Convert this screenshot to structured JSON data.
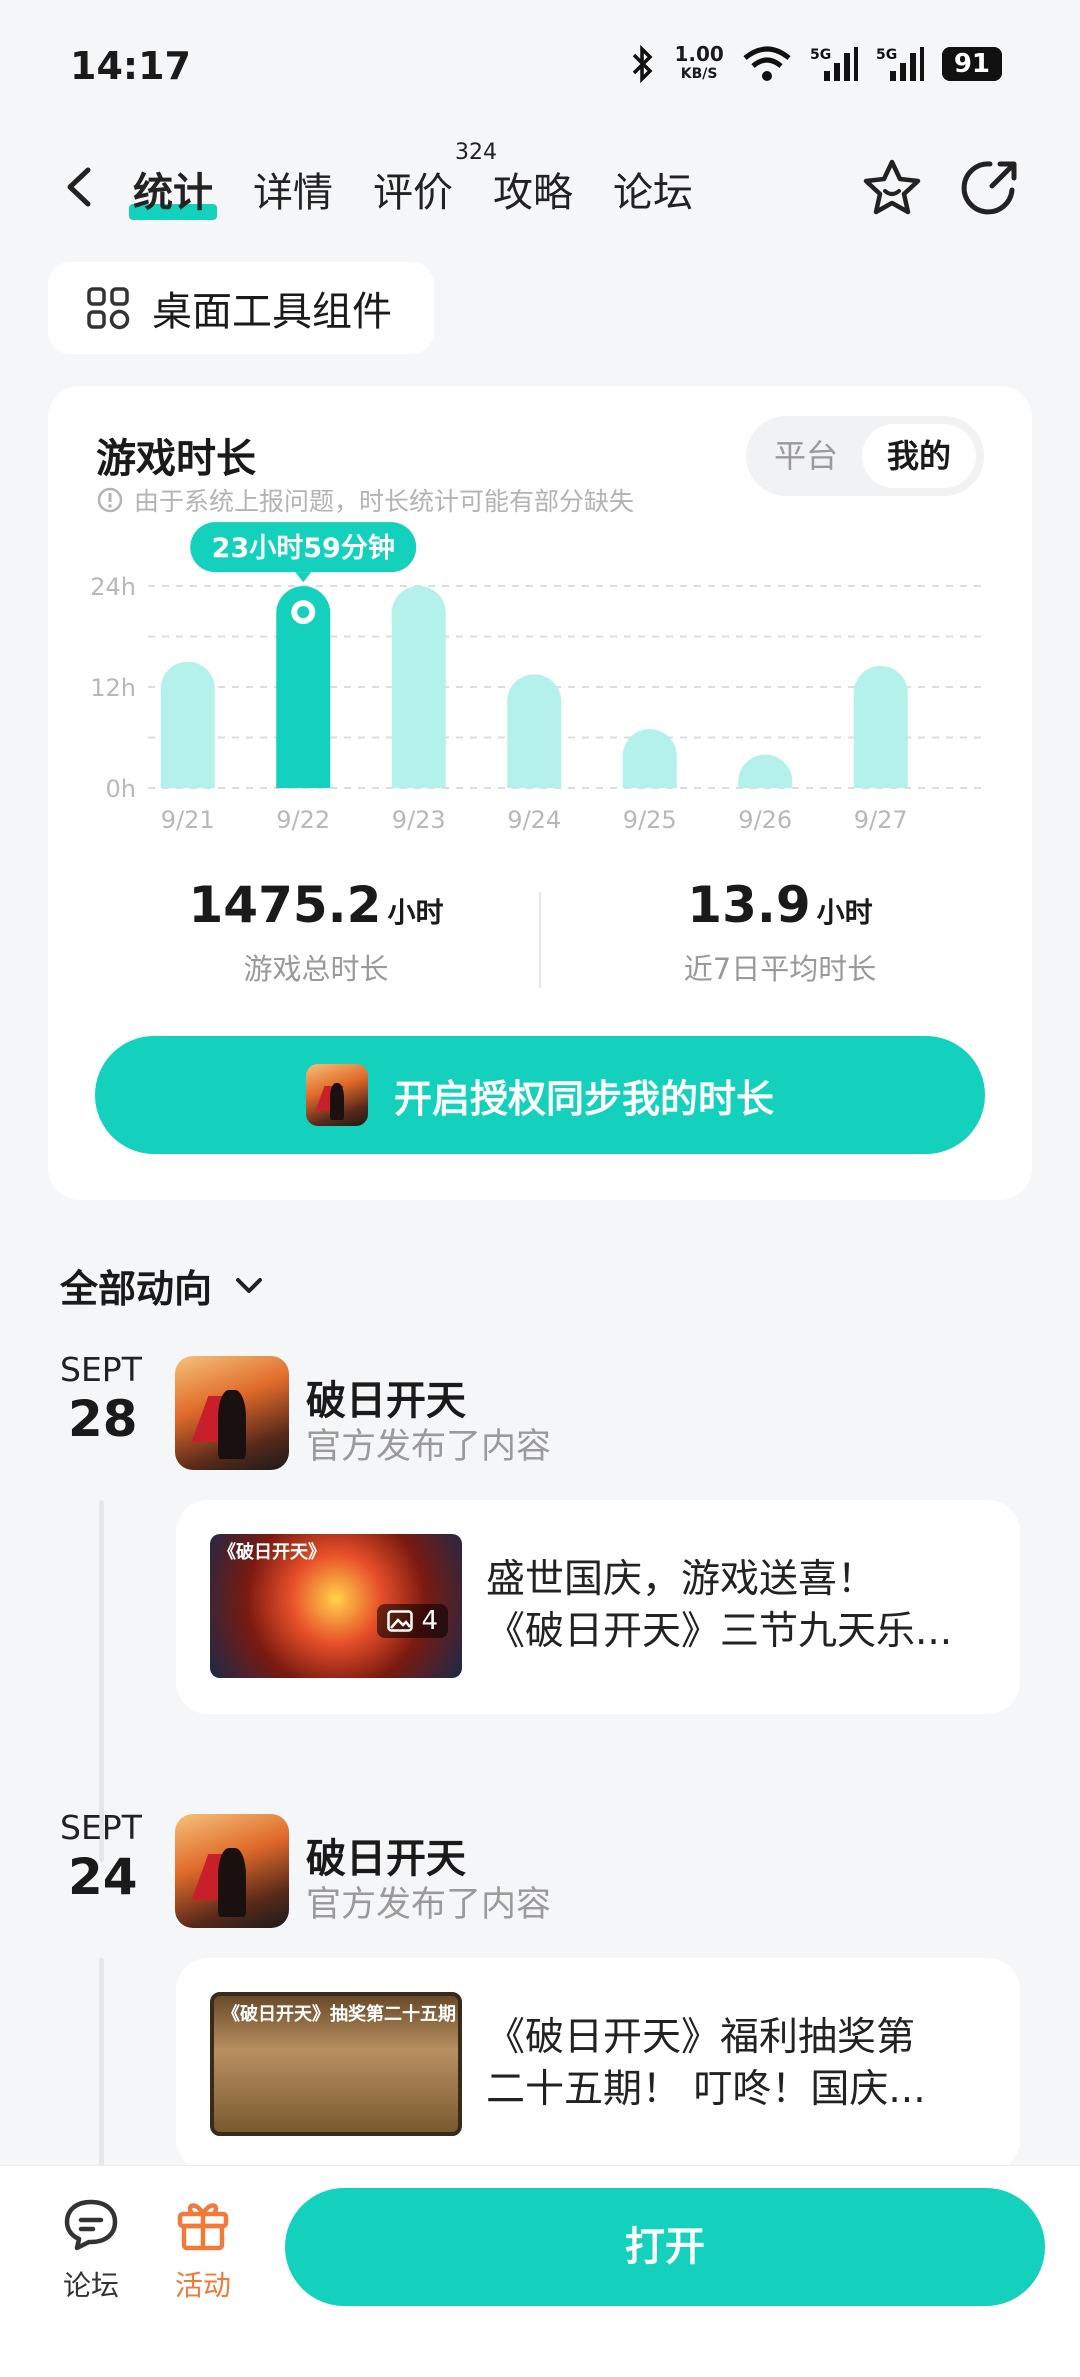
{
  "status_bar": {
    "time": "14:17",
    "net_speed": "1.00",
    "net_unit": "KB/S",
    "sig1": "5G",
    "sig2": "5G",
    "battery": "91"
  },
  "nav": {
    "tabs": [
      {
        "label": "统计",
        "active": true
      },
      {
        "label": "详情"
      },
      {
        "label": "评价",
        "badge": "324"
      },
      {
        "label": "攻略"
      },
      {
        "label": "论坛"
      }
    ]
  },
  "widget_button": {
    "label": "桌面工具组件"
  },
  "stats_card": {
    "title": "游戏时长",
    "note": "由于系统上报问题，时长统计可能有部分缺失",
    "toggle": {
      "platform": "平台",
      "mine": "我的"
    },
    "tooltip": "23小时59分钟",
    "total": {
      "value": "1475.2",
      "unit": "小时",
      "label": "游戏总时长"
    },
    "average": {
      "value": "13.9",
      "unit": "小时",
      "label": "近7日平均时长"
    },
    "sync_button": "开启授权同步我的时长"
  },
  "chart_data": {
    "type": "bar",
    "categories": [
      "9/21",
      "9/22",
      "9/23",
      "9/24",
      "9/25",
      "9/26",
      "9/27"
    ],
    "values": [
      15,
      23.98,
      24,
      13.5,
      7,
      1.5,
      14.5
    ],
    "yticks": [
      "0h",
      "12h",
      "24h"
    ],
    "ylim": [
      0,
      24
    ],
    "highlight_index": 1,
    "colors": {
      "bar": "#b3f1ea",
      "highlight": "#14d1be",
      "grid": "#dddddd"
    }
  },
  "feed": {
    "header": "全部动向",
    "posts": [
      {
        "month": "SEPT",
        "day": "28",
        "author": "破日开天",
        "action": "官方发布了内容",
        "image_caption": "《破日开天》",
        "image_count": "4",
        "line1": "盛世国庆，游戏送喜！",
        "line2": "《破日开天》三节九天乐..."
      },
      {
        "month": "SEPT",
        "day": "24",
        "author": "破日开天",
        "action": "官方发布了内容",
        "image_caption": "《破日开天》抽奖第二十五期",
        "line1": "《破日开天》福利抽奖第",
        "line2": "二十五期！ 叮咚！国庆..."
      }
    ]
  },
  "bottom_bar": {
    "forum": "论坛",
    "activity": "活动",
    "open": "打开"
  }
}
